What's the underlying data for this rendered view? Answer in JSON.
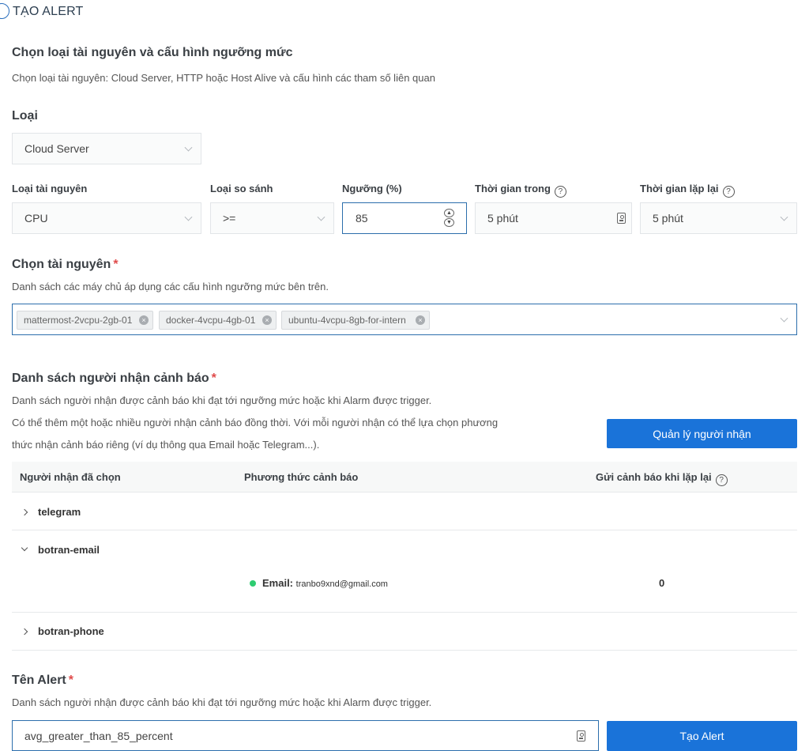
{
  "page": {
    "title": "TẠO ALERT"
  },
  "resource_config": {
    "heading": "Chọn loại tài nguyên và cấu hình ngưỡng mức",
    "description": "Chọn loại tài nguyên: Cloud Server, HTTP hoặc Host Alive và cấu hình các tham số liên quan",
    "type_label": "Loại",
    "type_value": "Cloud Server",
    "resource_type_label": "Loại tài nguyên",
    "resource_type_value": "CPU",
    "compare_label": "Loại so sánh",
    "compare_value": ">=",
    "threshold_label": "Ngưỡng (%)",
    "threshold_value": "85",
    "duration_label": "Thời gian trong",
    "duration_value": "5 phút",
    "repeat_label": "Thời gian lặp lại",
    "repeat_value": "5 phút"
  },
  "resources": {
    "heading": "Chọn tài nguyên",
    "required_mark": "*",
    "description": "Danh sách các máy chủ áp dụng các cấu hình ngưỡng mức bên trên.",
    "selected": [
      "mattermost-2vcpu-2gb-01",
      "docker-4vcpu-4gb-01",
      "ubuntu-4vcpu-8gb-for-intern"
    ]
  },
  "recipients": {
    "heading": "Danh sách người nhận cảnh báo",
    "required_mark": "*",
    "description1": "Danh sách người nhận được cảnh báo khi đạt tới ngưỡng mức hoặc khi Alarm được trigger.",
    "description2a": "Có thể thêm một hoặc nhiều người nhận cảnh báo đồng thời. Với mỗi người nhận có thể lựa chọn phương",
    "description2b": "thức nhận cảnh báo riêng (ví dụ thông qua Email hoặc Telegram...).",
    "manage_button": "Quản lý người nhận",
    "table": {
      "col_recipient": "Người nhận đã chọn",
      "col_method": "Phương thức cảnh báo",
      "col_repeat": "Gửi cảnh báo khi lặp lại",
      "rows": [
        {
          "name": "telegram",
          "expanded": false
        },
        {
          "name": "botran-email",
          "expanded": true,
          "method_label": "Email:",
          "method_value": "tranbo9xnd@gmail.com",
          "repeat_count": "0"
        },
        {
          "name": "botran-phone",
          "expanded": false
        }
      ]
    },
    "status_color": "#2ecc71"
  },
  "alert_name": {
    "heading": "Tên Alert",
    "required_mark": "*",
    "description": "Danh sách người nhận được cảnh báo khi đạt tới ngưỡng mức hoặc khi Alarm được trigger.",
    "value": "avg_greater_than_85_percent",
    "submit_button": "Tạo Alert"
  },
  "icons": {
    "help": "?",
    "tag_remove": "×",
    "spin_up": "▲",
    "spin_down": "▼"
  },
  "colors": {
    "primary": "#1a73d9",
    "required": "#e04a4a",
    "focus_border": "#2c6eac"
  }
}
